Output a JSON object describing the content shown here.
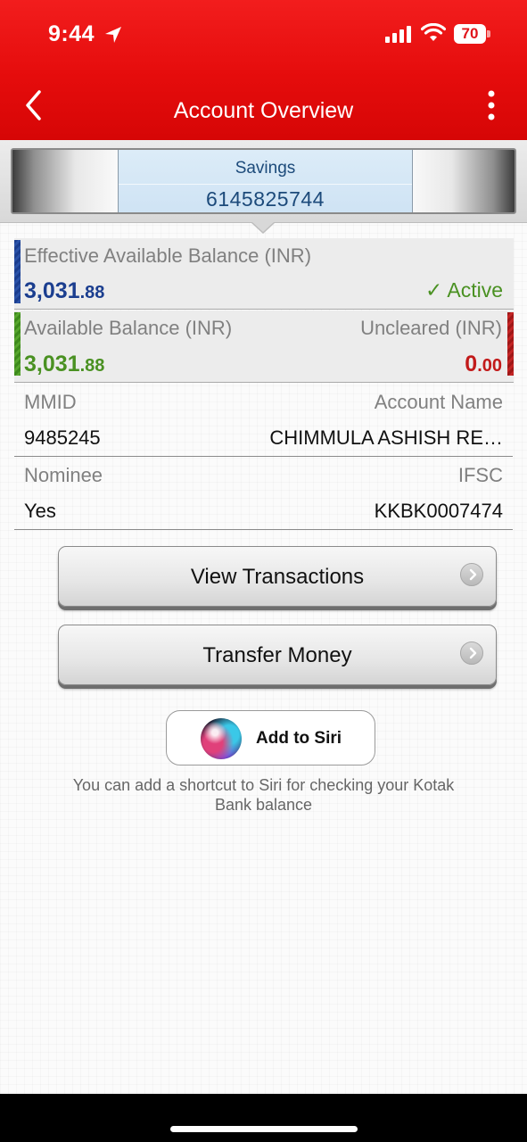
{
  "status_bar": {
    "time": "9:44",
    "battery": "70"
  },
  "header": {
    "title": "Account Overview"
  },
  "account": {
    "type": "Savings",
    "number": "6145825744"
  },
  "effective_balance": {
    "label": "Effective Available Balance (INR)",
    "whole": "3,031",
    "decimal": ".88",
    "status": "✓ Active"
  },
  "available_balance": {
    "label": "Available Balance (INR)",
    "whole": "3,031",
    "decimal": ".88"
  },
  "uncleared": {
    "label": "Uncleared (INR)",
    "whole": "0",
    "decimal": ".00"
  },
  "details": {
    "mmid_label": "MMID",
    "mmid_value": "9485245",
    "account_name_label": "Account Name",
    "account_name_value": "CHIMMULA ASHISH RE…",
    "nominee_label": "Nominee",
    "nominee_value": "Yes",
    "ifsc_label": "IFSC",
    "ifsc_value": "KKBK0007474"
  },
  "actions": {
    "view_transactions": "View Transactions",
    "transfer_money": "Transfer Money"
  },
  "siri": {
    "button_label": "Add to Siri",
    "hint": "You can add a shortcut to Siri for checking your Kotak Bank balance"
  },
  "colors": {
    "header_red": "#e50c0c",
    "balance_blue": "#1b3e8f",
    "balance_green": "#4a9122",
    "uncleared_red": "#c21a1a"
  },
  "icons": [
    "location-arrow-icon",
    "signal-icon",
    "wifi-icon",
    "battery-icon",
    "back-chevron-icon",
    "more-vertical-icon",
    "chevron-right-icon",
    "siri-icon"
  ]
}
